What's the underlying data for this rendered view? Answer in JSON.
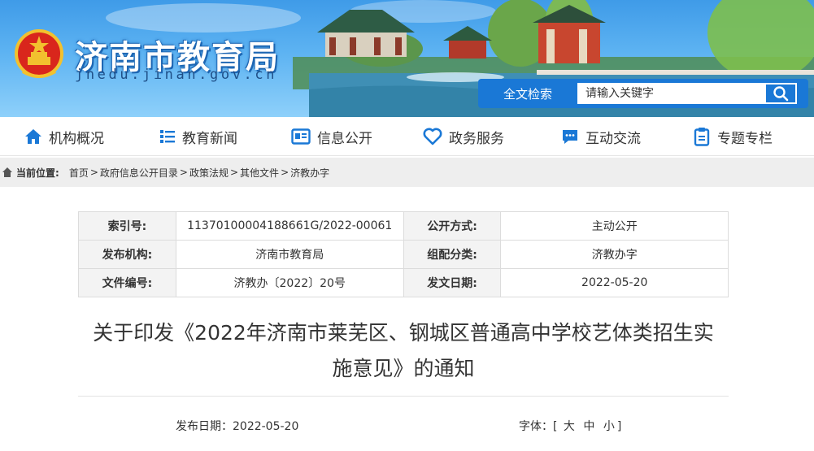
{
  "header": {
    "site_title": "济南市教育局",
    "site_domain": "jnedu.jinan.gov.cn",
    "search": {
      "label": "全文检索",
      "placeholder": "请输入关键字"
    }
  },
  "nav": [
    {
      "label": "机构概况",
      "icon": "home-icon"
    },
    {
      "label": "教育新闻",
      "icon": "list-icon"
    },
    {
      "label": "信息公开",
      "icon": "document-icon"
    },
    {
      "label": "政务服务",
      "icon": "heart-icon"
    },
    {
      "label": "互动交流",
      "icon": "chat-icon"
    },
    {
      "label": "专题专栏",
      "icon": "clipboard-icon"
    }
  ],
  "breadcrumb": {
    "label": "当前位置:",
    "items": [
      "首页",
      "政府信息公开目录",
      "政策法规",
      "其他文件",
      "济教办字"
    ]
  },
  "info": {
    "index_key": "索引号:",
    "index_val": "11370100004188661G/2022-00061",
    "open_key": "公开方式:",
    "open_val": "主动公开",
    "org_key": "发布机构:",
    "org_val": "济南市教育局",
    "cat_key": "组配分类:",
    "cat_val": "济教办字",
    "num_key": "文件编号:",
    "num_val": "济教办〔2022〕20号",
    "date_key": "发文日期:",
    "date_val": "2022-05-20"
  },
  "document": {
    "title_line1": "关于印发《2022年济南市莱芜区、钢城区普通高中学校艺体类招生实",
    "title_line2": "施意见》的通知",
    "publish_date_label": "发布日期：",
    "publish_date": "2022-05-20",
    "font_label": "字体：",
    "font_open": "[",
    "font_large": "大",
    "font_medium": "中",
    "font_small": "小",
    "font_close": "]"
  },
  "colors": {
    "nav_icon": "#1a78d6",
    "search_bg": "#1a78d6",
    "crumb_bg": "#eeeeee"
  }
}
